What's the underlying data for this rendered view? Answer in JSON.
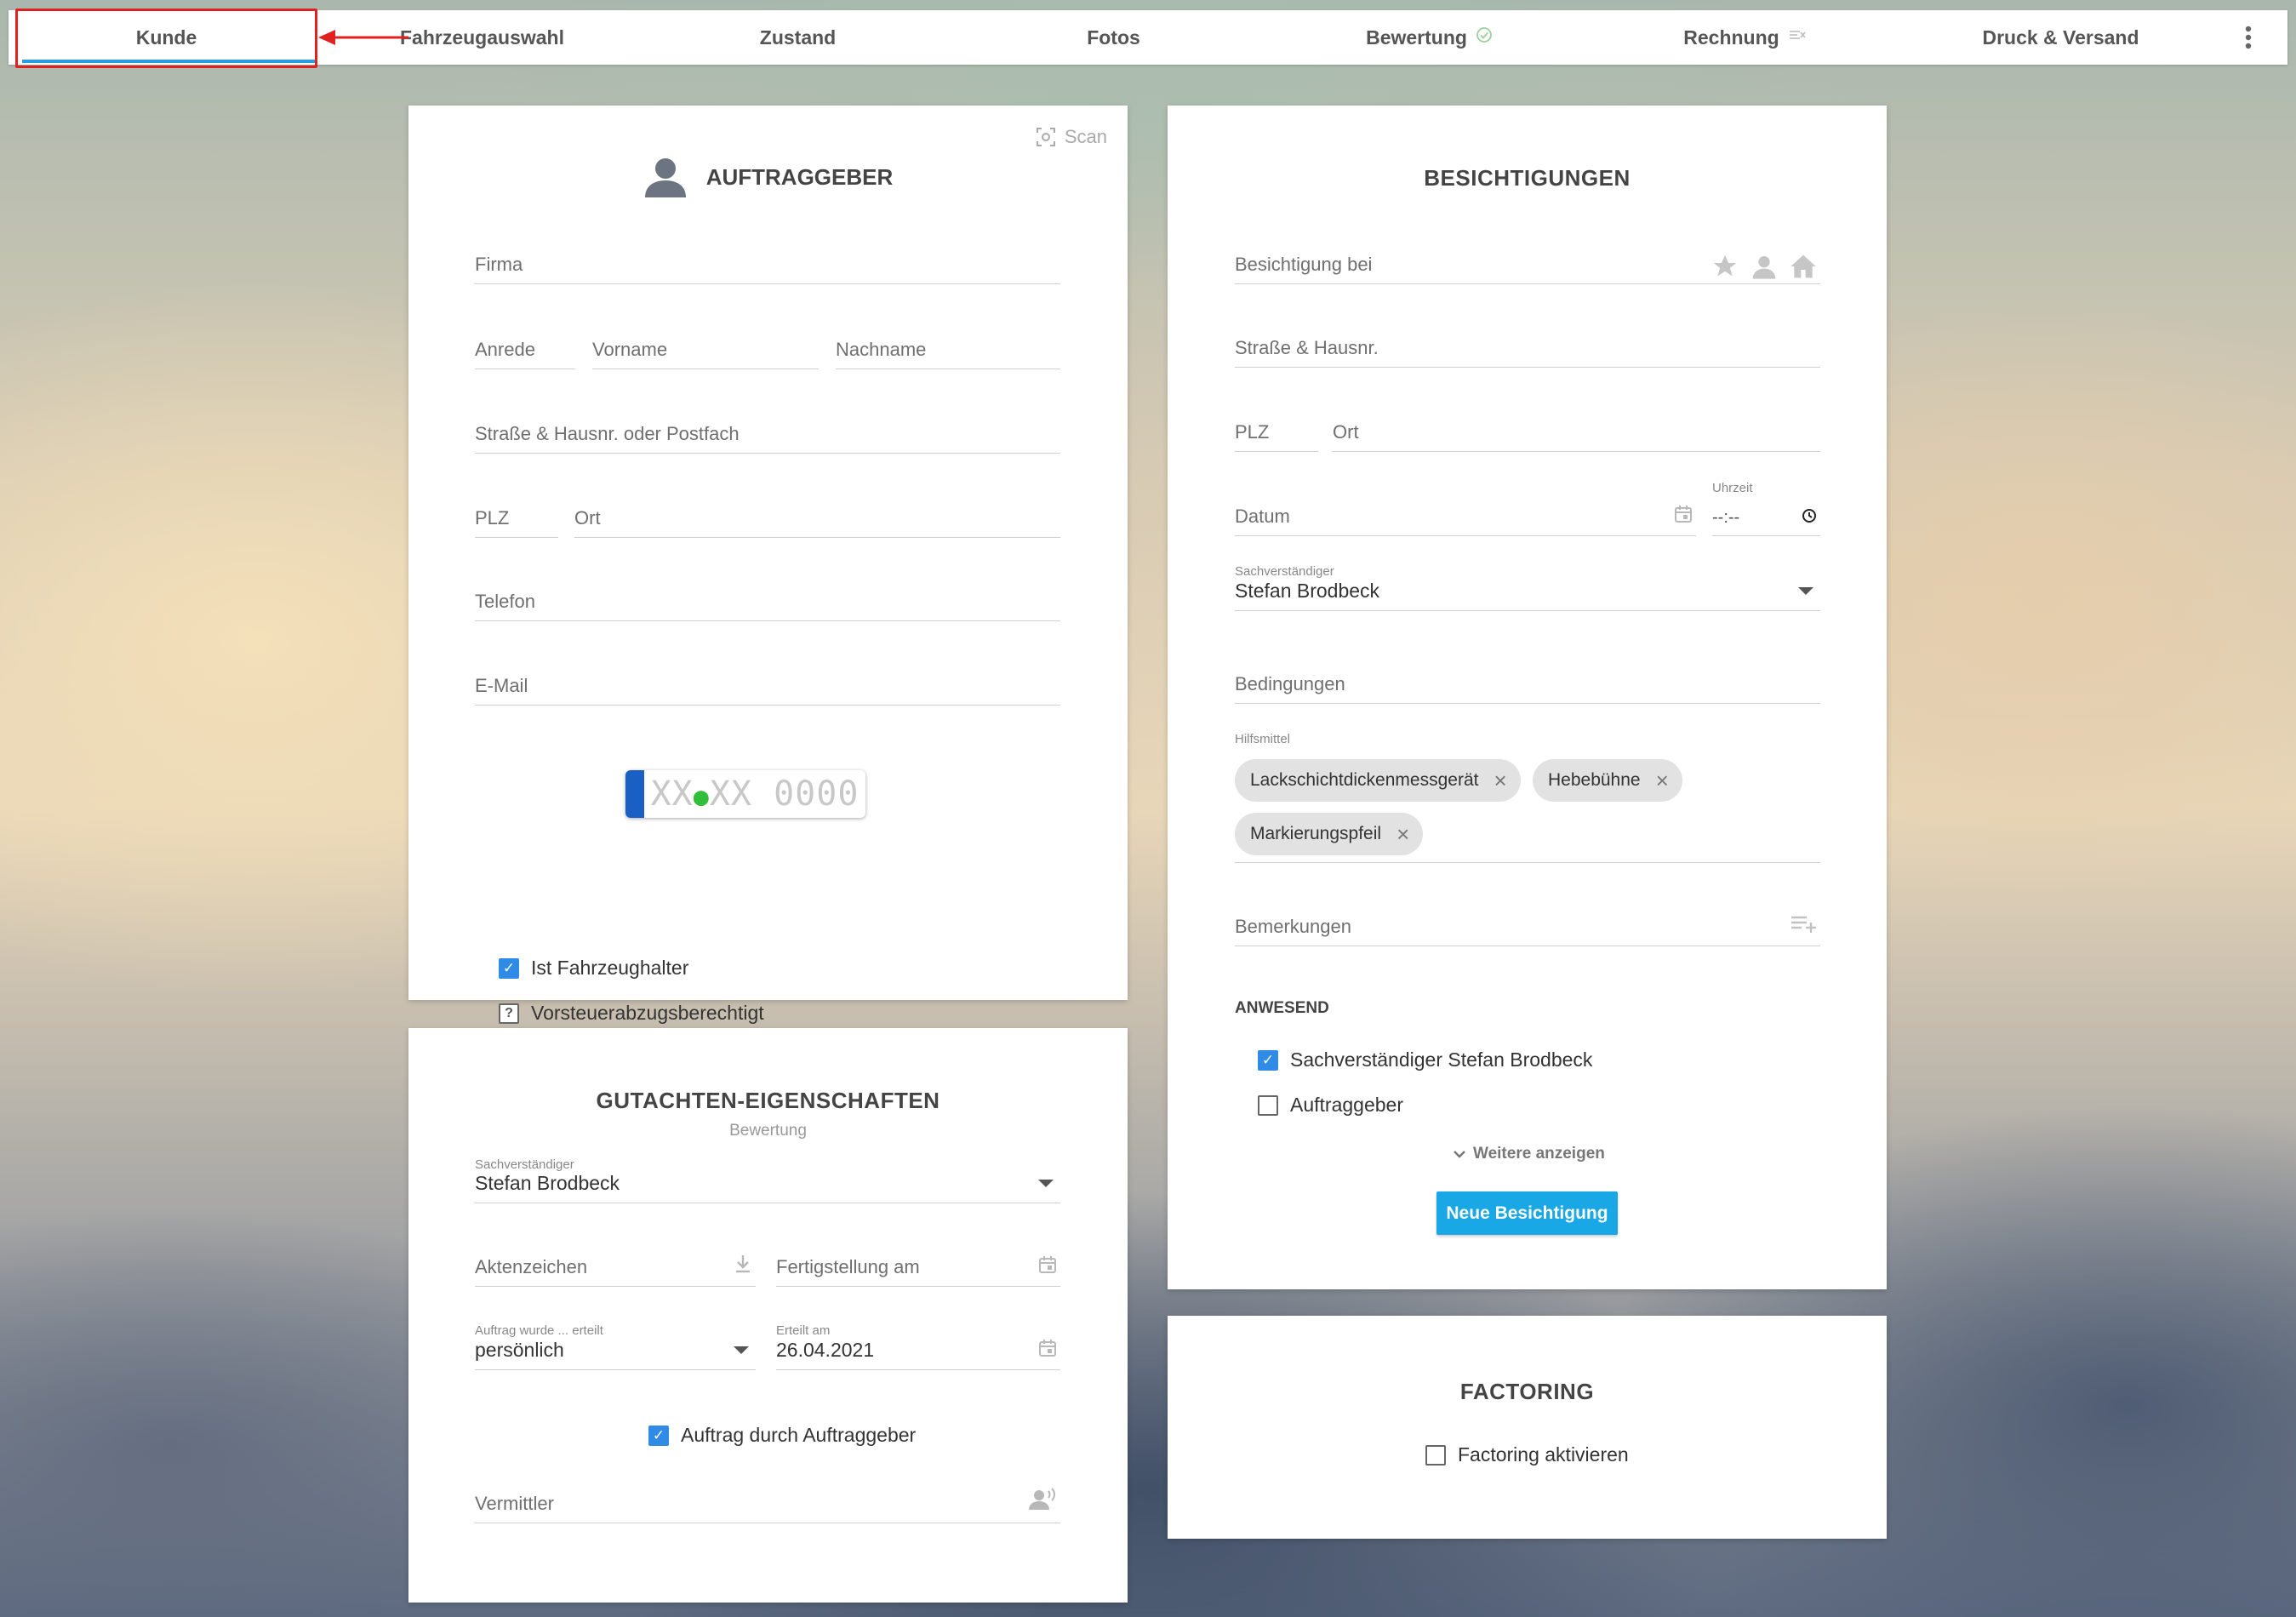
{
  "nav": {
    "tabs": [
      {
        "label": "Kunde"
      },
      {
        "label": "Fahrzeugauswahl"
      },
      {
        "label": "Zustand"
      },
      {
        "label": "Fotos"
      },
      {
        "label": "Bewertung",
        "icon": "check-circle-icon"
      },
      {
        "label": "Rechnung",
        "icon": "invoice-status-icon"
      },
      {
        "label": "Druck & Versand"
      }
    ],
    "active_tab": "Kunde",
    "more_icon": "more-vert-icon"
  },
  "auftraggeber": {
    "title": "AUFTRAGGEBER",
    "scan_label": "Scan",
    "fields": {
      "firma": "Firma",
      "anrede": "Anrede",
      "vorname": "Vorname",
      "nachname": "Nachname",
      "strasse": "Straße & Hausnr. oder Postfach",
      "plz": "PLZ",
      "ort": "Ort",
      "telefon": "Telefon",
      "email": "E-Mail"
    },
    "plate": {
      "left": "XX",
      "right": "XX 0000"
    },
    "checkboxes": {
      "fahrzeughalter": {
        "label": "Ist Fahrzeughalter",
        "checked": true
      },
      "vorsteuer": {
        "label": "Vorsteuerabzugsberechtigt",
        "checked": false
      }
    }
  },
  "gutachten": {
    "title": "GUTACHTEN-EIGENSCHAFTEN",
    "subtitle": "Bewertung",
    "sachverstaendiger_label": "Sachverständiger",
    "sachverstaendiger_value": "Stefan Brodbeck",
    "aktenzeichen": "Aktenzeichen",
    "fertigstellung": "Fertigstellung am",
    "auftrag_label": "Auftrag wurde ... erteilt",
    "auftrag_value": "persönlich",
    "erteilt_label": "Erteilt am",
    "erteilt_value": "26.04.2021",
    "auftrag_checkbox": {
      "label": "Auftrag durch Auftraggeber",
      "checked": true
    },
    "vermittler": "Vermittler"
  },
  "besichtigungen": {
    "title": "BESICHTIGUNGEN",
    "besichtigung_bei": "Besichtigung bei",
    "strasse": "Straße & Hausnr.",
    "plz": "PLZ",
    "ort": "Ort",
    "datum": "Datum",
    "uhrzeit_label": "Uhrzeit",
    "uhrzeit_value": "--:--",
    "sachverstaendiger_label": "Sachverständiger",
    "sachverstaendiger_value": "Stefan Brodbeck",
    "bedingungen": "Bedingungen",
    "hilfsmittel_label": "Hilfsmittel",
    "chips": [
      "Lackschichtdickenmessgerät",
      "Hebebühne",
      "Markierungspfeil"
    ],
    "bemerkungen": "Bemerkungen",
    "anwesend_heading": "ANWESEND",
    "anwesend": [
      {
        "label": "Sachverständiger Stefan Brodbeck",
        "checked": true
      },
      {
        "label": "Auftraggeber",
        "checked": false
      }
    ],
    "weitere": "Weitere anzeigen",
    "neue_button": "Neue Besichtigung"
  },
  "factoring": {
    "title": "FACTORING",
    "checkbox": {
      "label": "Factoring aktivieren",
      "checked": false
    }
  },
  "colors": {
    "accent": "#2a9ee0",
    "button": "#19a7e6",
    "checkbox": "#2f8be6",
    "highlight": "#e0221f"
  }
}
